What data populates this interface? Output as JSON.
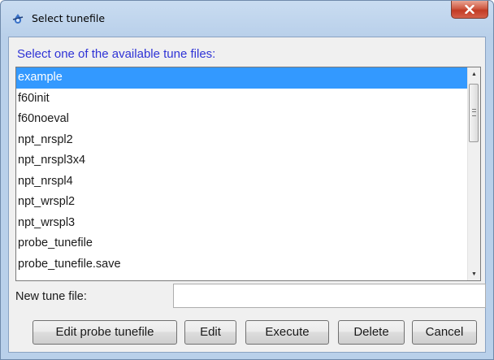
{
  "window": {
    "title": "Select tunefile"
  },
  "prompt": "Select one of the available tune files:",
  "tune_files": [
    {
      "label": "example",
      "selected": true
    },
    {
      "label": "f60init",
      "selected": false
    },
    {
      "label": "f60noeval",
      "selected": false
    },
    {
      "label": "npt_nrspl2",
      "selected": false
    },
    {
      "label": "npt_nrspl3x4",
      "selected": false
    },
    {
      "label": "npt_nrspl4",
      "selected": false
    },
    {
      "label": "npt_wrspl2",
      "selected": false
    },
    {
      "label": "npt_wrspl3",
      "selected": false
    },
    {
      "label": "probe_tunefile",
      "selected": false
    },
    {
      "label": "probe_tunefile.save",
      "selected": false
    }
  ],
  "new_tune_file": {
    "label": "New tune file:",
    "value": ""
  },
  "buttons": {
    "edit_probe": "Edit probe tunefile",
    "edit": "Edit",
    "execute": "Execute",
    "delete": "Delete",
    "cancel": "Cancel"
  },
  "colors": {
    "selection": "#3399ff",
    "prompt_text": "#2f33d6",
    "close_button": "#c94b35"
  },
  "icons": {
    "app": "topspin-icon",
    "close": "close-icon"
  }
}
